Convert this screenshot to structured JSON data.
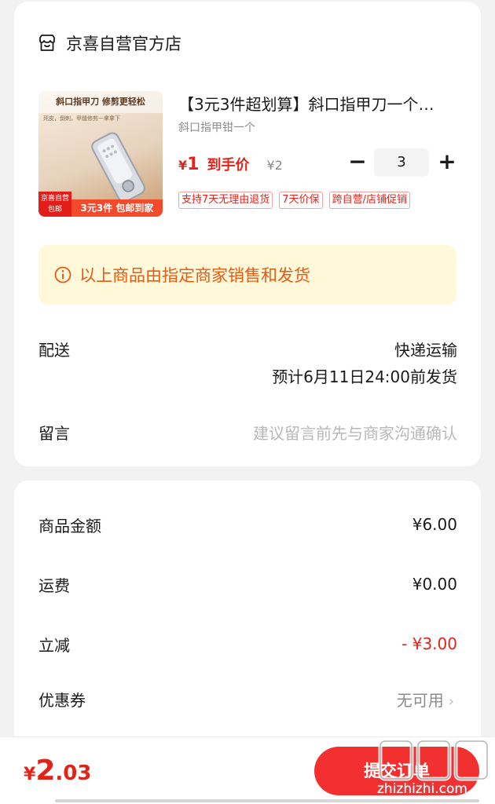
{
  "store": {
    "name": "京喜自营官方店",
    "icon": "store-icon"
  },
  "product": {
    "image_text": {
      "banner": "斜口指甲刀 修剪更轻松",
      "sub": "死皮，倒刺，甲缝修剪一拿拿下",
      "badge_left_1": "京喜自营",
      "badge_left_2": "包邮",
      "badge_right": "3元3件  包邮到家"
    },
    "title": "【3元3件超划算】斜口指甲刀一个…",
    "spec": "斜口指甲钳一个",
    "price_symbol": "¥",
    "price": "1",
    "price_label": "到手价",
    "original_price": "¥2",
    "quantity": "3",
    "qty_minus": "−",
    "qty_plus": "+",
    "tags": [
      "支持7天无理由退货",
      "7天价保",
      "跨自营/店铺促销"
    ]
  },
  "notice": {
    "icon": "info-icon",
    "text": "以上商品由指定商家销售和发货"
  },
  "delivery": {
    "label": "配送",
    "method": "快递运输",
    "eta": "预计6月11日24:00前发货"
  },
  "message": {
    "label": "留言",
    "placeholder": "建议留言前先与商家沟通确认"
  },
  "summary": {
    "goods_label": "商品金额",
    "goods_value": "¥6.00",
    "shipping_label": "运费",
    "shipping_value": "¥0.00",
    "discount_label": "立减",
    "discount_value": "- ¥3.00",
    "coupon_label": "优惠券",
    "coupon_value": "无可用",
    "coupon_chevron": "›"
  },
  "footer": {
    "total_symbol": "¥",
    "total_int": "2",
    "total_dec": ".03",
    "submit_label": "提交订单"
  },
  "watermark": {
    "text": "zhizhizhi.com"
  },
  "colors": {
    "accent": "#e2231a",
    "notice_bg": "#fff8d9",
    "notice_text": "#e85a12",
    "button": "#f23030"
  }
}
